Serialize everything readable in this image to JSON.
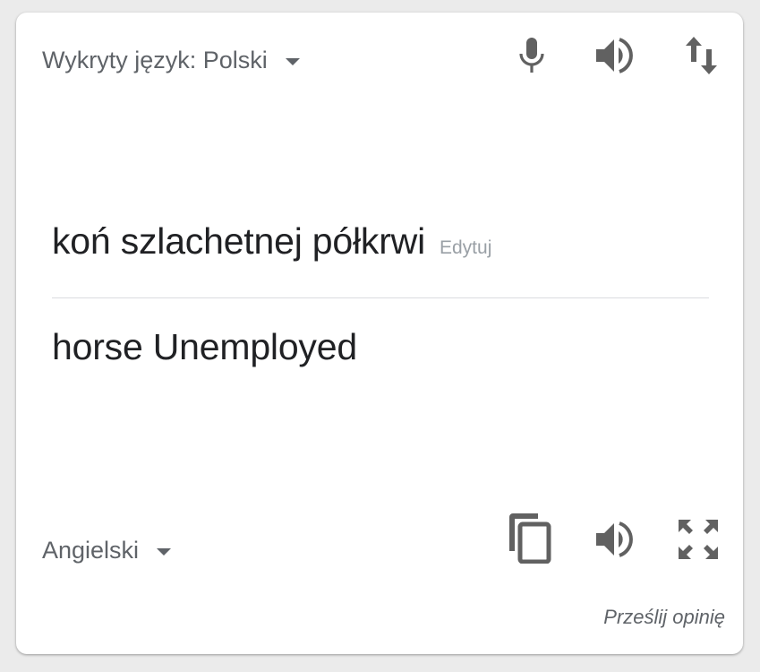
{
  "source": {
    "language_label": "Wykryty język: Polski",
    "text": "koń szlachetnej półkrwi",
    "edit_label": "Edytuj"
  },
  "target": {
    "language_label": "Angielski",
    "text": "horse Unemployed"
  },
  "toolbar": {
    "top_icons": [
      "microphone-icon",
      "speaker-icon",
      "swap-languages-icon"
    ],
    "bottom_icons": [
      "copy-icon",
      "speaker-icon",
      "fullscreen-icon"
    ]
  },
  "footer": {
    "feedback_label": "Prześlij opinię"
  },
  "colors": {
    "card_background": "#ffffff",
    "page_background": "#ebebeb",
    "icon": "#616161",
    "primary_text": "#202124",
    "secondary_text": "#5f6368",
    "muted_text": "#9aa0a6"
  }
}
